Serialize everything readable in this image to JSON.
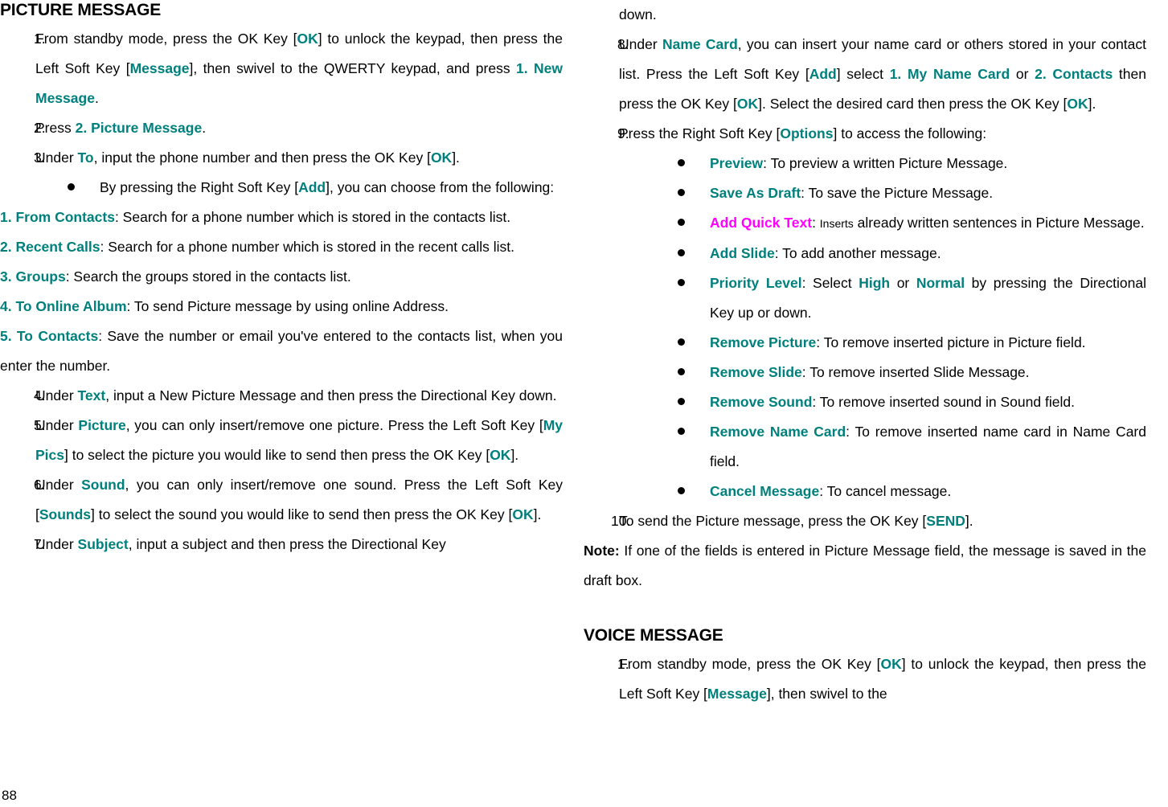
{
  "document": {
    "page_number": "88",
    "accent_teal": "#00807d",
    "accent_magenta": "#ff00ff"
  },
  "left_column": {
    "heading": "PICTURE MESSAGE",
    "step1": {
      "num": "1.",
      "t1": "From standby mode, press the OK Key [",
      "k1": "OK",
      "t2": "] to unlock the keypad, then press the Left Soft Key [",
      "k2": "Message",
      "t3": "], then swivel to the QWERTY keypad, and press ",
      "k3": "1. New Message",
      "t4": "."
    },
    "step2": {
      "num": "2.",
      "t1": "Press ",
      "k1": "2. Picture Message",
      "t2": "."
    },
    "step3": {
      "num": "3.",
      "t1": "Under ",
      "k1": "To",
      "t2": ", input the phone number and then press the OK Key [",
      "k2": "OK",
      "t3": "]."
    },
    "step3_bullet": {
      "t1": "By pressing the Right Soft Key [",
      "k1": "Add",
      "t2": "], you can choose from the following:"
    },
    "options": [
      {
        "label": "1. From Contacts",
        "text": ": Search for a phone number which is stored in the contacts list."
      },
      {
        "label": "2. Recent Calls",
        "text": ": Search for a phone number which is stored in the recent calls list."
      },
      {
        "label": "3. Groups",
        "text": ": Search the groups stored in the contacts list."
      },
      {
        "label": "4. To Online Album",
        "text": ": To send Picture message by using online Address."
      },
      {
        "label": "5. To Contacts",
        "text": ": Save the number or email you've entered to the contacts list, when you enter the number."
      }
    ],
    "step4": {
      "num": "4.",
      "t1": "Under ",
      "k1": "Text",
      "t2": ", input a New Picture Message and then press the Directional Key down."
    },
    "step5": {
      "num": "5.",
      "t1": "Under ",
      "k1": "Picture",
      "t2": ", you can only insert/remove one picture. Press the Left Soft Key [",
      "k2": "My Pics",
      "t3": "] to select the picture you would like to send then press the OK Key [",
      "k3": "OK",
      "t4": "]."
    },
    "step6": {
      "num": "6.",
      "t1": "Under ",
      "k1": "Sound",
      "t2": ", you can only insert/remove one sound. Press the Left Soft Key [",
      "k2": "Sounds",
      "t3": "] to select the sound you would like to send then press the OK Key [",
      "k3": "OK",
      "t4": "]."
    },
    "step7": {
      "num": "7.",
      "t1": "Under ",
      "k1": "Subject",
      "t2": ", input a subject and then press the Directional Key"
    }
  },
  "right_column": {
    "step7_cont": "down.",
    "step8": {
      "num": "8.",
      "t1": "Under ",
      "k1": "Name Card",
      "t2": ", you can insert your name card or others stored in your contact list. Press the Left Soft Key [",
      "k2": "Add",
      "t3": "] select ",
      "k3": "1. My Name Card",
      "t4": " or ",
      "k4": "2. Contacts",
      "t5": " then press the OK Key [",
      "k5": "OK",
      "t6": "]. Select the desired card then press the OK Key [",
      "k6": "OK",
      "t7": "]."
    },
    "step9": {
      "num": "9.",
      "t1": "Press the Right Soft Key [",
      "k1": "Options",
      "t2": "] to access the following:"
    },
    "option_bullets": [
      {
        "label": "Preview",
        "color": "teal",
        "text": ": To preview a written Picture Message.",
        "small_word": ""
      },
      {
        "label": "Save As Draft",
        "color": "teal",
        "text": ": To save the Picture Message.",
        "small_word": ""
      },
      {
        "label": "Add Quick Text",
        "color": "magenta",
        "text": " already written sentences in Picture Message.",
        "small_word": "Inserts"
      },
      {
        "label": "Add Slide",
        "color": "teal",
        "text": ": To add another message.",
        "small_word": ""
      },
      {
        "label": "Remove Picture",
        "color": "teal",
        "text": ": To remove inserted picture in Picture field.",
        "small_word": ""
      },
      {
        "label": "Remove Slide",
        "color": "teal",
        "text": ": To remove inserted Slide Message.",
        "small_word": ""
      },
      {
        "label": "Remove Sound",
        "color": "teal",
        "text": ": To remove inserted sound in Sound field.",
        "small_word": ""
      },
      {
        "label": "Remove Name Card",
        "color": "teal",
        "text": ": To remove inserted name card in Name Card field.",
        "small_word": ""
      },
      {
        "label": "Cancel Message",
        "color": "teal",
        "text": ": To cancel message.",
        "small_word": ""
      }
    ],
    "priority_bullet": {
      "label": "Priority Level",
      "t1": ": Select ",
      "k1": "High",
      "t2": " or ",
      "k2": "Normal",
      "t3": " by pressing the Directional Key up or down."
    },
    "step10": {
      "num": "10.",
      "t1": "To send the Picture message, press the OK Key [",
      "k1": "SEND",
      "t2": "]."
    },
    "note": {
      "label": "Note:",
      "text": " If one of the fields is entered in Picture Message field, the message is saved in the draft box."
    },
    "heading2": "VOICE MESSAGE",
    "voice_step1": {
      "num": "1.",
      "t1": "From standby mode, press the OK Key [",
      "k1": "OK",
      "t2": "] to unlock the keypad, then press the Left Soft Key [",
      "k2": "Message",
      "t3": "], then swivel to the"
    }
  }
}
